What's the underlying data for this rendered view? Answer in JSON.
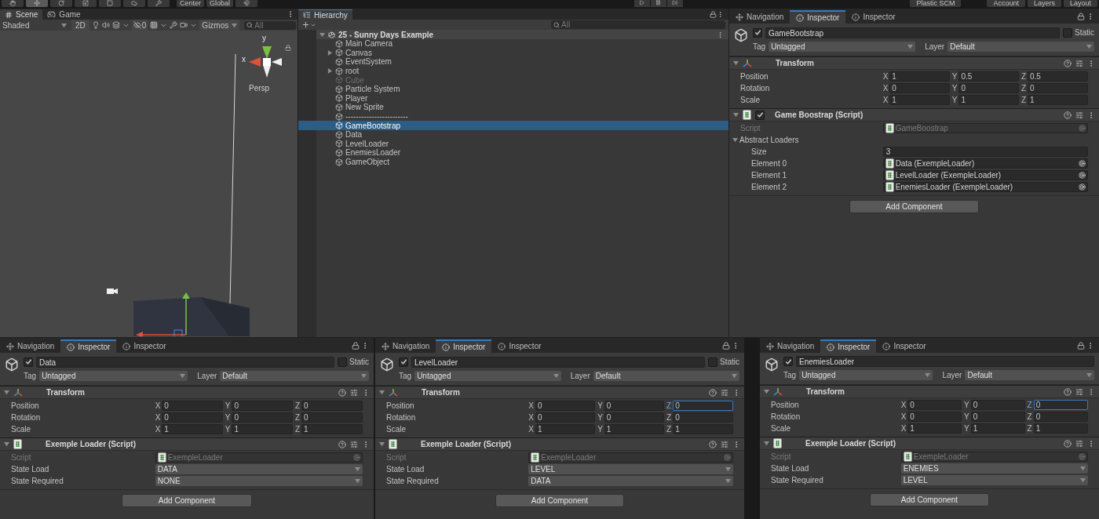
{
  "toolbar": {
    "pivot_buttons": [
      "Center",
      "Global"
    ],
    "right_buttons": [
      "Plastic SCM",
      "Account",
      "Layers",
      "Layout"
    ]
  },
  "scene": {
    "tabs": [
      {
        "label": "Scene",
        "kind": "scene",
        "selected": true
      },
      {
        "label": "Game",
        "kind": "game",
        "selected": false
      }
    ],
    "shading": "Shaded",
    "mode_2d": "2D",
    "hidden_count": "0",
    "gizmos": "Gizmos",
    "search_placeholder": "All",
    "axis_y": "y",
    "axis_x": "x",
    "projection": "Persp"
  },
  "hierarchy": {
    "title": "Hierarchy",
    "search_placeholder": "All",
    "scene_name": "25 - Sunny Days Example",
    "items": [
      {
        "name": "Main Camera",
        "has_children": false,
        "disabled": false,
        "selected": false
      },
      {
        "name": "Canvas",
        "has_children": true,
        "disabled": false,
        "selected": false
      },
      {
        "name": "EventSystem",
        "has_children": false,
        "disabled": false,
        "selected": false
      },
      {
        "name": "root",
        "has_children": true,
        "disabled": false,
        "selected": false
      },
      {
        "name": "Cube",
        "has_children": false,
        "disabled": true,
        "selected": false
      },
      {
        "name": "Particle System",
        "has_children": false,
        "disabled": false,
        "selected": false
      },
      {
        "name": "Player",
        "has_children": false,
        "disabled": false,
        "selected": false
      },
      {
        "name": "New Sprite",
        "has_children": false,
        "disabled": false,
        "selected": false
      },
      {
        "name": "------------------------",
        "has_children": false,
        "disabled": false,
        "selected": false
      },
      {
        "name": "GameBootstrap",
        "has_children": false,
        "disabled": false,
        "selected": true
      },
      {
        "name": "Data",
        "has_children": false,
        "disabled": false,
        "selected": false
      },
      {
        "name": "LevelLoader",
        "has_children": false,
        "disabled": false,
        "selected": false
      },
      {
        "name": "EnemiesLoader",
        "has_children": false,
        "disabled": false,
        "selected": false
      },
      {
        "name": "GameObject",
        "has_children": false,
        "disabled": false,
        "selected": false
      }
    ]
  },
  "inspectors": [
    {
      "tabs": [
        {
          "label": "Navigation",
          "kind": "navigation",
          "selected": false
        },
        {
          "label": "Inspector",
          "kind": "inspector",
          "selected": true
        },
        {
          "label": "Inspector",
          "kind": "inspector",
          "selected": false
        }
      ],
      "object": {
        "name": "GameBootstrap",
        "active": true,
        "static": false,
        "static_label": "Static",
        "tag_label": "Tag",
        "tag": "Untagged",
        "layer_label": "Layer",
        "layer": "Default"
      },
      "components": [
        {
          "kind": "transform",
          "title": "Transform",
          "rows": [
            {
              "label": "Position",
              "values": [
                {
                  "axis": "X",
                  "value": "1",
                  "focused": false
                },
                {
                  "axis": "Y",
                  "value": "0.5",
                  "focused": false
                },
                {
                  "axis": "Z",
                  "value": "0.5",
                  "focused": false
                }
              ]
            },
            {
              "label": "Rotation",
              "values": [
                {
                  "axis": "X",
                  "value": "0",
                  "focused": false
                },
                {
                  "axis": "Y",
                  "value": "0",
                  "focused": false
                },
                {
                  "axis": "Z",
                  "value": "0",
                  "focused": false
                }
              ]
            },
            {
              "label": "Scale",
              "values": [
                {
                  "axis": "X",
                  "value": "1",
                  "focused": false
                },
                {
                  "axis": "Y",
                  "value": "1",
                  "focused": false
                },
                {
                  "axis": "Z",
                  "value": "1",
                  "focused": false
                }
              ]
            }
          ]
        },
        {
          "kind": "script",
          "title": "Game Boostrap (Script)",
          "enabled": true,
          "fields": [
            {
              "kind": "object",
              "label": "Script",
              "value": "GameBoostrap",
              "disabled": true
            },
            {
              "kind": "foldout",
              "label": "Abstract Loaders",
              "expanded": true,
              "children": [
                {
                  "kind": "number",
                  "label": "Size",
                  "value": "3",
                  "disabled": false
                },
                {
                  "kind": "object",
                  "label": "Element 0",
                  "value": "Data (ExempleLoader)",
                  "disabled": false
                },
                {
                  "kind": "object",
                  "label": "Element 1",
                  "value": "LevelLoader (ExempleLoader)",
                  "disabled": false
                },
                {
                  "kind": "object",
                  "label": "Element 2",
                  "value": "EnemiesLoader (ExempleLoader)",
                  "disabled": false
                }
              ]
            }
          ]
        }
      ],
      "add_component": "Add Component"
    },
    {
      "tabs": [
        {
          "label": "Navigation",
          "kind": "navigation",
          "selected": false
        },
        {
          "label": "Inspector",
          "kind": "inspector",
          "selected": true
        },
        {
          "label": "Inspector",
          "kind": "inspector",
          "selected": false
        }
      ],
      "object": {
        "name": "Data",
        "active": true,
        "static": false,
        "static_label": "Static",
        "tag_label": "Tag",
        "tag": "Untagged",
        "layer_label": "Layer",
        "layer": "Default"
      },
      "components": [
        {
          "kind": "transform",
          "title": "Transform",
          "rows": [
            {
              "label": "Position",
              "values": [
                {
                  "axis": "X",
                  "value": "0",
                  "focused": false
                },
                {
                  "axis": "Y",
                  "value": "0",
                  "focused": false
                },
                {
                  "axis": "Z",
                  "value": "0",
                  "focused": false
                }
              ]
            },
            {
              "label": "Rotation",
              "values": [
                {
                  "axis": "X",
                  "value": "0",
                  "focused": false
                },
                {
                  "axis": "Y",
                  "value": "0",
                  "focused": false
                },
                {
                  "axis": "Z",
                  "value": "0",
                  "focused": false
                }
              ]
            },
            {
              "label": "Scale",
              "values": [
                {
                  "axis": "X",
                  "value": "1",
                  "focused": false
                },
                {
                  "axis": "Y",
                  "value": "1",
                  "focused": false
                },
                {
                  "axis": "Z",
                  "value": "1",
                  "focused": false
                }
              ]
            }
          ]
        },
        {
          "kind": "script",
          "title": "Exemple Loader (Script)",
          "fields": [
            {
              "kind": "object",
              "label": "Script",
              "value": "ExempleLoader",
              "disabled": true
            },
            {
              "kind": "enum",
              "label": "State Load",
              "value": "DATA",
              "disabled": false
            },
            {
              "kind": "enum",
              "label": "State Required",
              "value": "NONE",
              "disabled": false
            }
          ]
        }
      ],
      "add_component": "Add Component"
    },
    {
      "tabs": [
        {
          "label": "Navigation",
          "kind": "navigation",
          "selected": false
        },
        {
          "label": "Inspector",
          "kind": "inspector",
          "selected": true
        },
        {
          "label": "Inspector",
          "kind": "inspector",
          "selected": false
        }
      ],
      "object": {
        "name": "LevelLoader",
        "active": true,
        "static": false,
        "static_label": "Static",
        "tag_label": "Tag",
        "tag": "Untagged",
        "layer_label": "Layer",
        "layer": "Default"
      },
      "components": [
        {
          "kind": "transform",
          "title": "Transform",
          "rows": [
            {
              "label": "Position",
              "values": [
                {
                  "axis": "X",
                  "value": "0",
                  "focused": false
                },
                {
                  "axis": "Y",
                  "value": "0",
                  "focused": false
                },
                {
                  "axis": "Z",
                  "value": "0",
                  "focused": true
                }
              ]
            },
            {
              "label": "Rotation",
              "values": [
                {
                  "axis": "X",
                  "value": "0",
                  "focused": false
                },
                {
                  "axis": "Y",
                  "value": "0",
                  "focused": false
                },
                {
                  "axis": "Z",
                  "value": "0",
                  "focused": false
                }
              ]
            },
            {
              "label": "Scale",
              "values": [
                {
                  "axis": "X",
                  "value": "1",
                  "focused": false
                },
                {
                  "axis": "Y",
                  "value": "1",
                  "focused": false
                },
                {
                  "axis": "Z",
                  "value": "1",
                  "focused": false
                }
              ]
            }
          ]
        },
        {
          "kind": "script",
          "title": "Exemple Loader (Script)",
          "fields": [
            {
              "kind": "object",
              "label": "Script",
              "value": "ExempleLoader",
              "disabled": true
            },
            {
              "kind": "enum",
              "label": "State Load",
              "value": "LEVEL",
              "disabled": false
            },
            {
              "kind": "enum",
              "label": "State Required",
              "value": "DATA",
              "disabled": false
            }
          ]
        }
      ],
      "add_component": "Add Component"
    },
    {
      "tabs": [
        {
          "label": "Navigation",
          "kind": "navigation",
          "selected": false
        },
        {
          "label": "Inspector",
          "kind": "inspector",
          "selected": true
        },
        {
          "label": "Inspector",
          "kind": "inspector",
          "selected": false
        }
      ],
      "object": {
        "name": "EnemiesLoader",
        "active": true,
        "tag_label": "Tag",
        "tag": "Untagged",
        "layer_label": "Layer",
        "layer": "Default"
      },
      "components": [
        {
          "kind": "transform",
          "title": "Transform",
          "rows": [
            {
              "label": "Position",
              "values": [
                {
                  "axis": "X",
                  "value": "0",
                  "focused": false
                },
                {
                  "axis": "Y",
                  "value": "0",
                  "focused": false
                },
                {
                  "axis": "Z",
                  "value": "0",
                  "focused": true
                }
              ]
            },
            {
              "label": "Rotation",
              "values": [
                {
                  "axis": "X",
                  "value": "0",
                  "focused": false
                },
                {
                  "axis": "Y",
                  "value": "0",
                  "focused": false
                },
                {
                  "axis": "Z",
                  "value": "0",
                  "focused": false
                }
              ]
            },
            {
              "label": "Scale",
              "values": [
                {
                  "axis": "X",
                  "value": "1",
                  "focused": false
                },
                {
                  "axis": "Y",
                  "value": "1",
                  "focused": false
                },
                {
                  "axis": "Z",
                  "value": "1",
                  "focused": false
                }
              ]
            }
          ]
        },
        {
          "kind": "script",
          "title": "Exemple Loader (Script)",
          "fields": [
            {
              "kind": "object",
              "label": "Script",
              "value": "ExempleLoader",
              "disabled": true
            },
            {
              "kind": "enum",
              "label": "State Load",
              "value": "ENEMIES",
              "disabled": false
            },
            {
              "kind": "enum",
              "label": "State Required",
              "value": "LEVEL",
              "disabled": false
            }
          ]
        }
      ],
      "add_component": "Add Component"
    }
  ]
}
